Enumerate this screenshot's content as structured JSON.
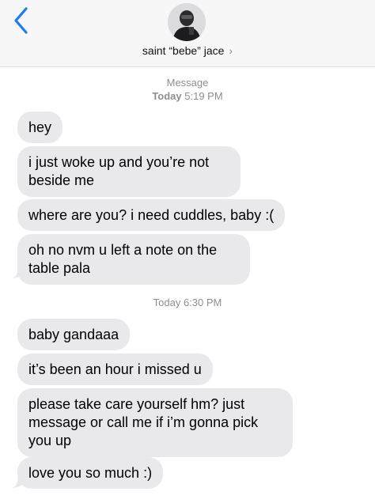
{
  "header": {
    "contact_name": "saint “bebe” jace",
    "chevron": "›",
    "back_icon": "chevron-left-icon"
  },
  "conversation": {
    "thread_label": "Message",
    "first_timestamp_day": "Today",
    "first_timestamp_time": "5:19 PM",
    "second_timestamp_day": "Today",
    "second_timestamp_time": "6:30 PM",
    "messages": [
      {
        "text": "hey"
      },
      {
        "text": "i just woke up and you’re not beside me"
      },
      {
        "text": "where are you? i need cuddles, baby :("
      },
      {
        "text": "oh no nvm u left a note on the table pala"
      },
      {
        "text": "baby gandaaa"
      },
      {
        "text": "it’s been an hour i missed u"
      },
      {
        "text": "please take care yourself hm? just message or call me if i’m gonna pick you up"
      },
      {
        "text": "love you so much :)"
      }
    ]
  },
  "colors": {
    "accent": "#1a7cf5",
    "bubble_incoming": "#e9e9eb",
    "meta_text": "#8e8e93"
  }
}
